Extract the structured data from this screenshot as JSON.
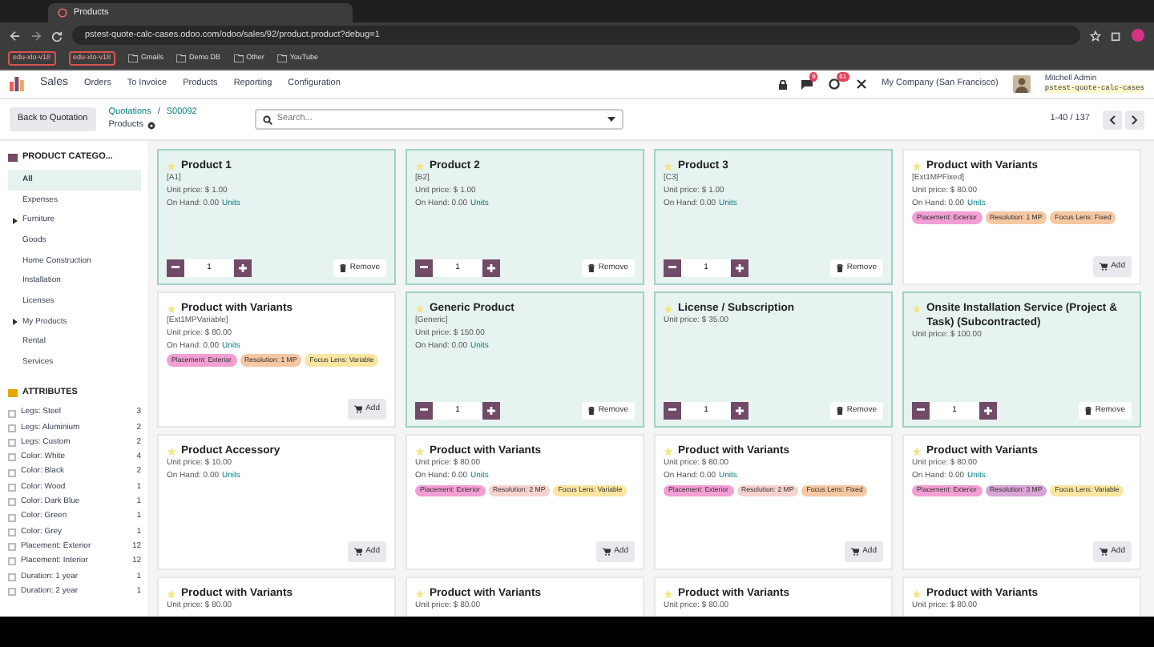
{
  "browser": {
    "tab_title": "Products",
    "url": "pstest-quote-calc-cases.odoo.com/odoo/sales/92/product.product?debug=1",
    "bookmarks": [
      {
        "kind": "badge",
        "label": "edu-xlo-v18"
      },
      {
        "kind": "badge",
        "label": "edu-xlo-v18"
      },
      {
        "kind": "folder",
        "label": "Gmails"
      },
      {
        "kind": "folder",
        "label": "Demo DB"
      },
      {
        "kind": "folder",
        "label": "Other"
      },
      {
        "kind": "folder",
        "label": "YouTube"
      }
    ]
  },
  "navbar": {
    "app": "Sales",
    "menu": [
      "Orders",
      "To Invoice",
      "Products",
      "Reporting",
      "Configuration"
    ],
    "messages_badge": "9",
    "activities_badge": "61",
    "company": "My Company (San Francisco)",
    "user": "Mitchell Admin",
    "database": "pstest-quote-calc-cases"
  },
  "control_panel": {
    "back_button": "Back to Quotation",
    "breadcrumb": [
      "Quotations",
      "S00092"
    ],
    "breadcrumb_separator": "/",
    "title": "Products",
    "search": {
      "placeholder": "Search..."
    },
    "pager": "1-40 / 137"
  },
  "sidebar": {
    "categories_title": "PRODUCT CATEGO...",
    "categories": [
      {
        "label": "All",
        "selected": true,
        "expandable": false
      },
      {
        "label": "Expenses",
        "selected": false,
        "expandable": false
      },
      {
        "label": "Furniture",
        "selected": false,
        "expandable": true
      },
      {
        "label": "Goods",
        "selected": false,
        "expandable": false
      },
      {
        "label": "Home Construction",
        "selected": false,
        "expandable": false
      },
      {
        "label": "Installation",
        "selected": false,
        "expandable": false
      },
      {
        "label": "Licenses",
        "selected": false,
        "expandable": false
      },
      {
        "label": "My Products",
        "selected": false,
        "expandable": true
      },
      {
        "label": "Rental",
        "selected": false,
        "expandable": false
      },
      {
        "label": "Services",
        "selected": false,
        "expandable": false
      }
    ],
    "attributes_title": "ATTRIBUTES",
    "attributes": [
      {
        "label": "Legs: Steel",
        "count": "3",
        "checked": false
      },
      {
        "label": "Legs: Aluminium",
        "count": "2",
        "checked": false
      },
      {
        "label": "Legs: Custom",
        "count": "2",
        "checked": false
      },
      {
        "label": "Color: White",
        "count": "4",
        "checked": false
      },
      {
        "label": "Color: Black",
        "count": "2",
        "checked": false
      },
      {
        "label": "Color: Wood",
        "count": "1",
        "checked": false
      },
      {
        "label": "Color: Dark Blue",
        "count": "1",
        "checked": false
      },
      {
        "label": "Color: Green",
        "count": "1",
        "checked": false
      },
      {
        "label": "Color: Grey",
        "count": "1",
        "checked": false
      },
      {
        "label": "Placement: Exterior",
        "count": "12",
        "checked": false
      },
      {
        "label": "Placement: Interior",
        "count": "12",
        "checked": false
      },
      {
        "label": "Duration: 1 year",
        "count": "1",
        "checked": false
      },
      {
        "label": "Duration: 2 year",
        "count": "1",
        "checked": false
      }
    ]
  },
  "cards": [
    {
      "name": "Product 1",
      "ref": "[A1]",
      "price": "Unit price: $ 1.00",
      "on_hand": "On Hand: 0.00",
      "units": "Units",
      "in_order": true,
      "qty": "1",
      "action": "Remove"
    },
    {
      "name": "Product 2",
      "ref": "[B2]",
      "price": "Unit price: $ 1.00",
      "on_hand": "On Hand: 0.00",
      "units": "Units",
      "in_order": true,
      "qty": "1",
      "action": "Remove"
    },
    {
      "name": "Product 3",
      "ref": "[C3]",
      "price": "Unit price: $ 1.00",
      "on_hand": "On Hand: 0.00",
      "units": "Units",
      "in_order": true,
      "qty": "1",
      "action": "Remove"
    },
    {
      "name": "Product with Variants",
      "ref": "[Ext1MPFixed]",
      "price": "Unit price: $ 80.00",
      "on_hand": "On Hand: 0.00",
      "units": "Units",
      "tags": [
        {
          "label": "Placement: Exterior",
          "color": "#f39fd4"
        },
        {
          "label": "Resolution: 1 MP",
          "color": "#f5c7a2"
        },
        {
          "label": "Focus Lens: Fixed",
          "color": "#f5c7a2"
        }
      ],
      "in_order": false,
      "action": "Add"
    },
    {
      "name": "Product with Variants",
      "ref": "[Ext1MPVariable]",
      "price": "Unit price: $ 80.00",
      "on_hand": "On Hand: 0.00",
      "units": "Units",
      "tags": [
        {
          "label": "Placement: Exterior",
          "color": "#f39fd4"
        },
        {
          "label": "Resolution: 1 MP",
          "color": "#f5c7a2"
        },
        {
          "label": "Focus Lens: Variable",
          "color": "#f9e6a0"
        }
      ],
      "in_order": false,
      "action": "Add"
    },
    {
      "name": "Generic Product",
      "ref": "[Generic]",
      "price": "Unit price: $ 150.00",
      "on_hand": "On Hand: 0.00",
      "units": "Units",
      "in_order": true,
      "qty": "1",
      "action": "Remove"
    },
    {
      "name": "License / Subscription",
      "price": "Unit price: $ 35.00",
      "in_order": true,
      "qty": "1",
      "action": "Remove"
    },
    {
      "name": "Onsite Installation Service (Project & Task) (Subcontracted)",
      "price": "Unit price: $ 100.00",
      "in_order": true,
      "qty": "1",
      "action": "Remove"
    },
    {
      "name": "Product Accessory",
      "price": "Unit price: $ 10.00",
      "on_hand": "On Hand: 0.00",
      "units": "Units",
      "in_order": false,
      "action": "Add"
    },
    {
      "name": "Product with Variants",
      "price": "Unit price: $ 80.00",
      "on_hand": "On Hand: 0.00",
      "units": "Units",
      "tags": [
        {
          "label": "Placement: Exterior",
          "color": "#f39fd4"
        },
        {
          "label": "Resolution: 2 MP",
          "color": "#f6d2ce"
        },
        {
          "label": "Focus Lens: Variable",
          "color": "#f9e6a0"
        }
      ],
      "in_order": false,
      "action": "Add"
    },
    {
      "name": "Product with Variants",
      "price": "Unit price: $ 80.00",
      "on_hand": "On Hand: 0.00",
      "units": "Units",
      "tags": [
        {
          "label": "Placement: Exterior",
          "color": "#f39fd4"
        },
        {
          "label": "Resolution: 2 MP",
          "color": "#f6d2ce"
        },
        {
          "label": "Focus Lens: Fixed",
          "color": "#f5c7a2"
        }
      ],
      "in_order": false,
      "action": "Add"
    },
    {
      "name": "Product with Variants",
      "price": "Unit price: $ 80.00",
      "on_hand": "On Hand: 0.00",
      "units": "Units",
      "tags": [
        {
          "label": "Placement: Exterior",
          "color": "#f39fd4"
        },
        {
          "label": "Resolution: 3 MP",
          "color": "#d9a5d8"
        },
        {
          "label": "Focus Lens: Variable",
          "color": "#f9e6a0"
        }
      ],
      "in_order": false,
      "action": "Add"
    },
    {
      "name": "Product with Variants",
      "price": "Unit price: $ 80.00",
      "in_order": false
    },
    {
      "name": "Product with Variants",
      "price": "Unit price: $ 80.00",
      "in_order": false
    },
    {
      "name": "Product with Variants",
      "price": "Unit price: $ 80.00",
      "in_order": false
    },
    {
      "name": "Product with Variants",
      "price": "Unit price: $ 80.00",
      "in_order": false
    }
  ]
}
